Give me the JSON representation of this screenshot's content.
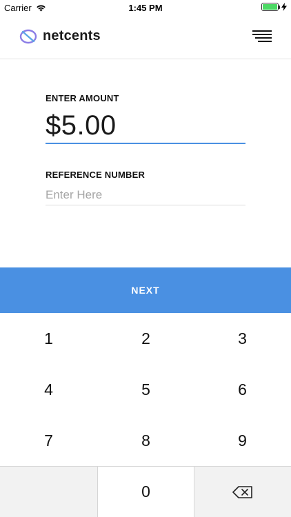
{
  "status_bar": {
    "carrier": "Carrier",
    "time": "1:45 PM"
  },
  "header": {
    "brand": "netcents",
    "brand_color": "#6e6ee0",
    "menu_icon": "hamburger-menu-icon"
  },
  "form": {
    "amount_label": "ENTER AMOUNT",
    "amount_value": "$5.00",
    "reference_label": "REFERENCE NUMBER",
    "reference_placeholder": "Enter Here",
    "reference_value": ""
  },
  "next_button": {
    "label": "NEXT",
    "color": "#4a90e2"
  },
  "keypad": {
    "keys": [
      "1",
      "2",
      "3",
      "4",
      "5",
      "6",
      "7",
      "8",
      "9",
      "",
      "0",
      "backspace"
    ],
    "delete_icon": "backspace-icon"
  }
}
